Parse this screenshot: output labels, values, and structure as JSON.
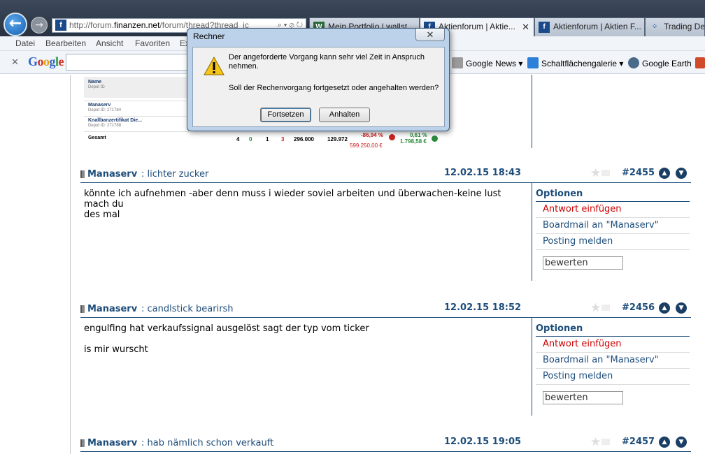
{
  "browser": {
    "address": {
      "prefix": "http://forum.",
      "domain": "finanzen.net",
      "suffix": "/forum/thread?thread_ic"
    },
    "tabs": [
      {
        "label": "Mein Portfolio | wallst..."
      },
      {
        "label": "Aktienforum | Aktie...",
        "close": "✕"
      },
      {
        "label": "Aktienforum | Aktien F..."
      },
      {
        "label": "Trading Des"
      }
    ],
    "menu": [
      "Datei",
      "Bearbeiten",
      "Ansicht",
      "Favoriten",
      "Ex"
    ],
    "toolbar": {
      "close": "✕",
      "google_logo": "Google",
      "items": [
        "Google News",
        "Schaltflächengalerie",
        "Google Earth"
      ]
    }
  },
  "depot_image": {
    "header_name": "Name",
    "header_sub": "Depot ID",
    "row1_name": "Manaserv",
    "row1_sub": "Depot ID: 271784",
    "row2_name": "Knallbanzertifikat Die...",
    "row2_sub": "Depot ID: 271788",
    "total_label": "Gesamt",
    "total_values": [
      "4",
      "0",
      "1",
      "3",
      "296.000",
      "129.972"
    ],
    "pct_neg": "-86,94 %",
    "amount_neg": "599.250,00 €",
    "pct_pos": "0,61 %",
    "amount_pos": "1.798,58 €"
  },
  "posts": [
    {
      "author": "Manaserv",
      "subject": ": lichter zucker",
      "date": "12.02.15 18:43",
      "number": "#2455",
      "body": "könnte ich aufnehmen -aber denn muss i wieder soviel arbeiten und überwachen-keine lust mach du\ndes mal",
      "options_title": "Optionen",
      "links": [
        "Antwort einfügen",
        "Boardmail an \"Manaserv\"",
        "Posting melden"
      ],
      "rate_placeholder": "bewerten"
    },
    {
      "author": "Manaserv",
      "subject": ": candlstick bearirsh",
      "date": "12.02.15 18:52",
      "number": "#2456",
      "body": "engulfing hat verkaufssignal ausgelöst sagt der typ vom ticker\n\nis mir wurscht",
      "options_title": "Optionen",
      "links": [
        "Antwort einfügen",
        "Boardmail an \"Manaserv\"",
        "Posting melden"
      ],
      "rate_placeholder": "bewerten"
    },
    {
      "author": "Manaserv",
      "subject": ": hab nämlich schon verkauft",
      "date": "12.02.15 19:05",
      "number": "#2457"
    }
  ],
  "dialog": {
    "title": "Rechner",
    "close": "✕",
    "message1": "Der angeforderte Vorgang kann sehr viel Zeit in Anspruch nehmen.",
    "message2": "Soll der Rechenvorgang fortgesetzt oder angehalten werden?",
    "button_continue": "Fortsetzen",
    "button_stop": "Anhalten"
  }
}
